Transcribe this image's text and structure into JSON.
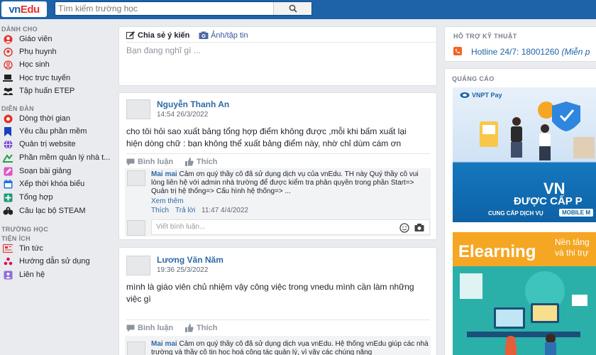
{
  "header": {
    "logo_main": "vn",
    "logo_accent": "Edu",
    "search_placeholder": "Tìm kiếm trường học"
  },
  "sidebar": {
    "sections": {
      "danh_cho": "DÀNH CHO",
      "dien_dan": "DIỄN ĐÀN",
      "truong_hoc": "TRƯỜNG HỌC",
      "tien_ich": "TIỆN ÍCH"
    },
    "danh_cho": [
      {
        "label": "Giáo viên",
        "icon": "teacher-icon"
      },
      {
        "label": "Phụ huynh",
        "icon": "parent-icon"
      },
      {
        "label": "Học sinh",
        "icon": "student-icon"
      },
      {
        "label": "Học trực tuyến",
        "icon": "laptop-icon"
      },
      {
        "label": "Tập huấn ETEP",
        "icon": "group-icon"
      }
    ],
    "dien_dan": [
      {
        "label": "Dòng thời gian",
        "icon": "timeline-icon"
      },
      {
        "label": "Yêu cầu phần mềm",
        "icon": "bookmark-icon"
      },
      {
        "label": "Quản trị website",
        "icon": "globe-icon"
      },
      {
        "label": "Phần mềm quản lý nhà t...",
        "icon": "software-icon"
      },
      {
        "label": "Soạn bài giảng",
        "icon": "pencil-icon"
      },
      {
        "label": "Xếp thời khóa biểu",
        "icon": "calendar-icon"
      },
      {
        "label": "Tổng hợp",
        "icon": "plus-icon"
      },
      {
        "label": "Câu lạc bộ STEAM",
        "icon": "club-icon"
      }
    ],
    "tien_ich": [
      {
        "label": "Tin tức",
        "icon": "news-icon"
      },
      {
        "label": "Hướng dẫn sử dụng",
        "icon": "guide-icon"
      },
      {
        "label": "Liên hệ",
        "icon": "contact-icon"
      }
    ]
  },
  "composer": {
    "tab_share": "Chia sẻ ý kiến",
    "tab_photo": "Ảnh/tập tin",
    "placeholder": "Bạn đang nghĩ gì ..."
  },
  "posts": [
    {
      "author": "Nguyễn Thanh An",
      "time": "14:54 26/3/2022",
      "text": "cho tôi hỏi sao xuất bảng tổng hợp điểm không được ,mỗi khi bấm xuất lại hiện dòng chữ : bạn không thể xuất bảng điểm này, nhờ chỉ dùm cám ơn",
      "comment_label": "Bình luận",
      "like_label": "Thích",
      "reply": {
        "name": "Mai mai",
        "text": "Cảm ơn quý thầy cô đã sử dụng dịch vụ của vnEdu. TH này Quý thầy cô vui lòng liên hệ với admin nhà trường để được kiểm tra phân quyền trong phần Start=> Quản trị hệ thống=> Cấu hình hệ thống=> ...",
        "see_more": "Xem thêm",
        "like": "Thích",
        "reply": "Trả lời",
        "time": "11:47 4/4/2022"
      },
      "comment_placeholder": "Viết bình luận..."
    },
    {
      "author": "Lương Văn Năm",
      "time": "19:36 25/3/2022",
      "text": "mình là giáo viên chủ nhiệm vậy công việc trong vnedu mình cần làm những việc gì",
      "comment_label": "Bình luận",
      "like_label": "Thích",
      "reply": {
        "name": "Mai mai",
        "text": "Cảm ơn quý thầy cô đã sử dụng dịch vụa vnEdu. Hệ thống vnEdu giúp các nhà trường và thầy cô tin học hoá công tác quản lý, vì vậy các chúng năng"
      }
    }
  ],
  "right": {
    "support_title": "HỖ TRỢ KỸ THUẬT",
    "hotline": "Hotline 24/7: 18001260",
    "hotline_note": "(Miễn p",
    "ads_title": "QUẢNG CÁO",
    "ad1": {
      "brand": "VNPT Pay",
      "big": "VN",
      "line1": "ĐƯỢC CẤP P",
      "line2": "CUNG CẤP DỊCH VỤ",
      "badge": "MOBILE M"
    },
    "ad2": {
      "title": "Elearning",
      "tag1": "Nền tảng",
      "tag2": "và thi trự"
    }
  },
  "colors": {
    "topbar": "#1e63a7",
    "link": "#2f6aa7",
    "page_bg": "#e9ebee"
  }
}
